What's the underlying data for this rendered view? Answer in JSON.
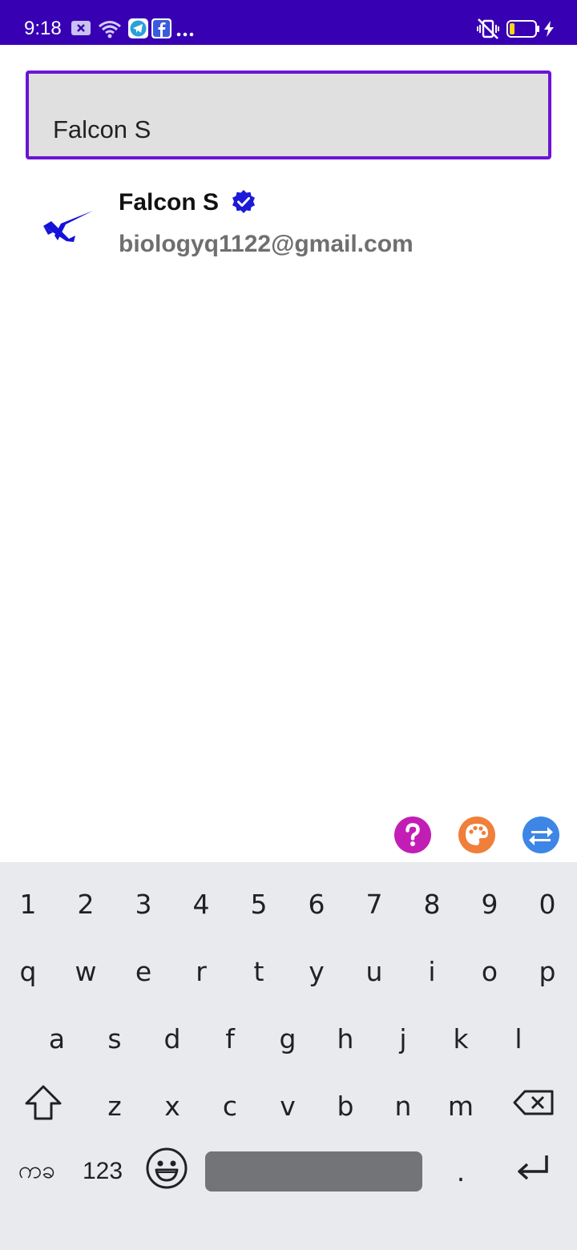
{
  "status_bar": {
    "time": "9:18",
    "background_color": "#3700b3",
    "left_icons": [
      "close-notification-icon",
      "wifi-icon",
      "telegram-icon",
      "facebook-icon",
      "more-notifications-icon"
    ],
    "right_icons": [
      "vibrate-off-icon",
      "battery-low-icon",
      "charging-icon"
    ]
  },
  "search": {
    "value": "Falcon S",
    "border_color": "#6b14d6"
  },
  "results": [
    {
      "name": "Falcon S",
      "email": "biologyq1122@gmail.com",
      "avatar_icon": "falcon-logo-icon",
      "verified": true
    }
  ],
  "floating_actions": [
    {
      "icon": "help-icon",
      "color": "#c21eb5"
    },
    {
      "icon": "palette-icon",
      "color": "#ef7f3a"
    },
    {
      "icon": "swap-icon",
      "color": "#3d86e6"
    }
  ],
  "keyboard": {
    "number_row": [
      "1",
      "2",
      "3",
      "4",
      "5",
      "6",
      "7",
      "8",
      "9",
      "0"
    ],
    "row1": [
      "q",
      "w",
      "e",
      "r",
      "t",
      "y",
      "u",
      "i",
      "o",
      "p"
    ],
    "row2": [
      "a",
      "s",
      "d",
      "f",
      "g",
      "h",
      "j",
      "k",
      "l"
    ],
    "row3": [
      "z",
      "x",
      "c",
      "v",
      "b",
      "n",
      "m"
    ],
    "language_label": "ကခ",
    "numbers_label": "123",
    "period_label": ".",
    "icons": [
      "shift-icon",
      "backspace-icon",
      "emoji-icon",
      "enter-icon"
    ]
  }
}
